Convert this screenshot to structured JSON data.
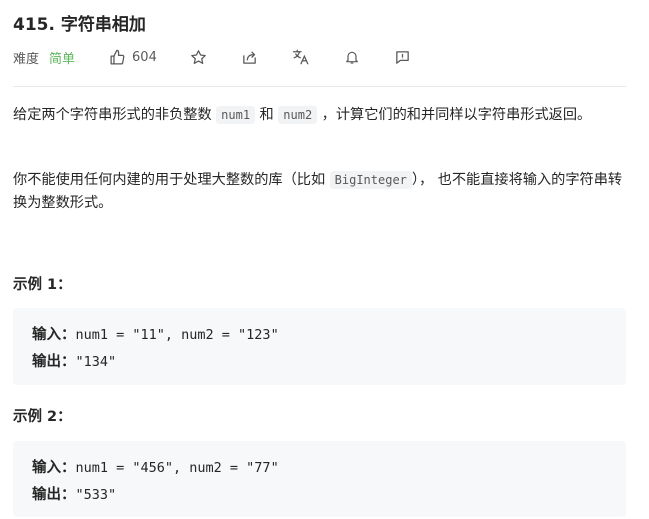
{
  "problem": {
    "title": "415. 字符串相加",
    "difficulty_label": "难度",
    "difficulty": "简单",
    "likes": "604"
  },
  "icons": [
    "thumbs-up-icon",
    "star-icon",
    "share-icon",
    "translate-icon",
    "bell-icon",
    "feedback-icon"
  ],
  "colors": {
    "easy": "#5cb85c",
    "code_bg": "#f2f3f5",
    "example_bg": "#f7f8fa"
  },
  "description": {
    "p1": {
      "t1": "给定两个字符串形式的非负整数 ",
      "c1": "num1",
      "t2": " 和",
      "c2": "num2",
      "t3": " ，计算它们的和并同样以字符串形式返回。"
    },
    "p2": {
      "t1": "你不能使用任何内建的用于处理大整数的库（比如 ",
      "c1": "BigInteger",
      "t2": "）， 也不能直接将输入的字符串转换为整数形式。"
    }
  },
  "examples": [
    {
      "heading": "示例 1：",
      "input_label": "输入：",
      "input": "num1 = \"11\", num2 = \"123\"",
      "output_label": "输出：",
      "output": "\"134\""
    },
    {
      "heading": "示例 2：",
      "input_label": "输入：",
      "input": "num1 = \"456\", num2 = \"77\"",
      "output_label": "输出：",
      "output": "\"533\""
    }
  ]
}
